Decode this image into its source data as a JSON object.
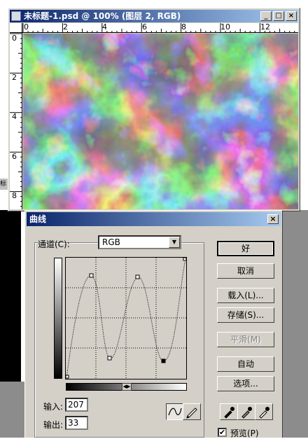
{
  "image_window": {
    "title": "未标题-1.psd @ 100% (图层 2, RGB)",
    "minimize_glyph": "_",
    "maximize_glyph": "□",
    "close_glyph": "×",
    "ruler_top_labels": [
      "0",
      "2",
      "4",
      "6",
      "8",
      "10",
      "12"
    ],
    "ruler_left_labels": [
      "0",
      "2",
      "4",
      "6",
      "8"
    ],
    "side_tab_text": "标"
  },
  "curves_dialog": {
    "title": "曲线",
    "close_glyph": "×",
    "channel_label": "通道(C):",
    "channel_value": "RGB",
    "input_label": "输入:",
    "input_value": "207",
    "output_label": "输出:",
    "output_value": "33",
    "buttons": {
      "ok": "好",
      "cancel": "取消",
      "load": "载入(L)...",
      "save": "存储(S)...",
      "smooth": "平滑(M)",
      "auto": "自动",
      "options": "选项..."
    },
    "preview_label": "预览(P)",
    "preview_checked": true,
    "check_glyph": "✔"
  },
  "colors": {
    "title_bar_start": "#0a246a",
    "title_bar_end": "#a6caf0",
    "dialog_face": "#d4d0c8"
  },
  "icons": [
    "curve-tool-icon",
    "pencil-icon",
    "black-eyedropper-icon",
    "gray-eyedropper-icon",
    "white-eyedropper-icon"
  ]
}
